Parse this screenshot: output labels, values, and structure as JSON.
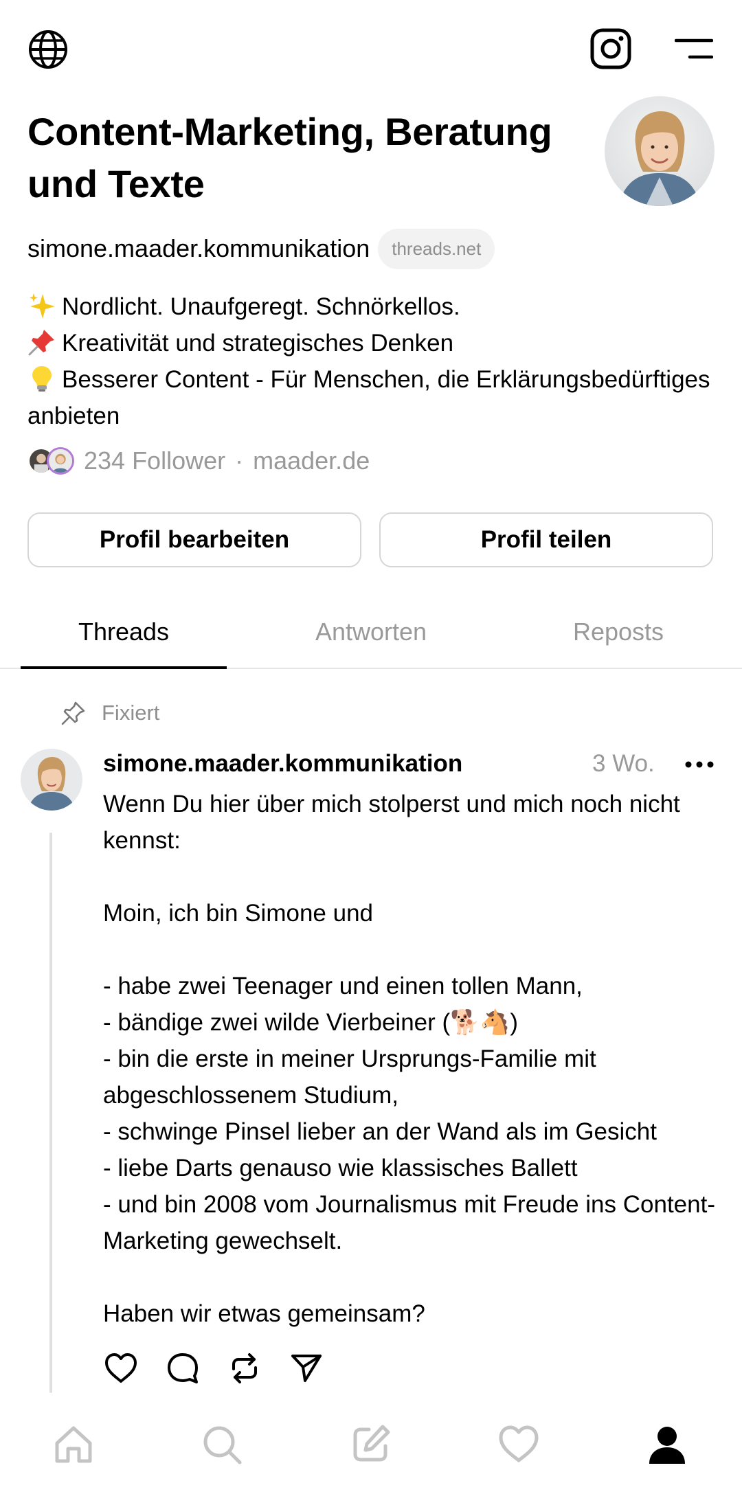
{
  "profile": {
    "display_name": "Content-Marketing, Beratung und Texte",
    "handle": "simone.maader.kommunikation",
    "domain_badge": "threads.net",
    "bio": [
      {
        "emoji": "sparkles",
        "text": "Nordlicht. Unaufgeregt. Schnörkellos."
      },
      {
        "emoji": "pushpin",
        "text": "Kreativität und strategisches Denken"
      },
      {
        "emoji": "light-bulb",
        "text": "Besserer Content - Für Menschen, die Erklärungsbedürftiges anbieten"
      }
    ],
    "followers_label": "234 Follower",
    "separator": "·",
    "website": "maader.de"
  },
  "buttons": {
    "edit": "Profil bearbeiten",
    "share": "Profil teilen"
  },
  "tabs": [
    {
      "label": "Threads",
      "active": true
    },
    {
      "label": "Antworten",
      "active": false
    },
    {
      "label": "Reposts",
      "active": false
    }
  ],
  "post": {
    "pinned_label": "Fixiert",
    "author": "simone.maader.kommunikation",
    "time": "3 Wo.",
    "body": "Wenn Du hier über mich stolperst und mich noch nicht kennst:\n\nMoin, ich bin Simone und\n\n- habe zwei Teenager und einen tollen Mann,\n- bändige zwei wilde Vierbeiner (🐕🐴)\n- bin die erste in meiner Ursprungs-Familie mit abgeschlossenem Studium,\n- schwinge Pinsel lieber an der Wand als im Gesicht\n- liebe Darts genauso wie klassisches Ballett\n- und bin 2008 vom Journalismus mit Freude ins Content-Marketing gewechselt.\n\nHaben wir etwas gemeinsam?"
  },
  "icons": {
    "top_left": "globe-icon",
    "top_right": [
      "instagram-icon",
      "menu-icon"
    ],
    "actions": [
      "heart-icon",
      "comment-icon",
      "repost-icon",
      "share-icon"
    ],
    "nav": [
      "home-icon",
      "search-icon",
      "compose-icon",
      "activity-icon",
      "profile-icon"
    ]
  },
  "colors": {
    "text": "#000000",
    "muted": "#999999",
    "border": "#d6d6d6",
    "pill_bg": "#f2f2f2"
  }
}
